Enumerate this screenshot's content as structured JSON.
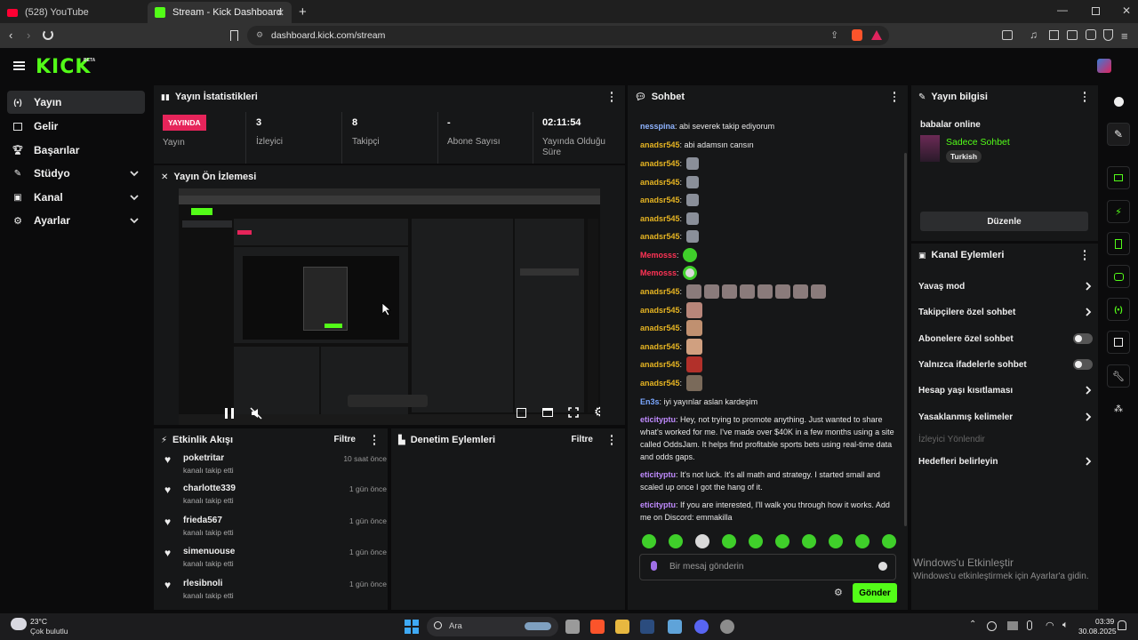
{
  "browser": {
    "tabs": [
      {
        "title": "(528) YouTube"
      },
      {
        "title": "Stream - Kick Dashboard"
      }
    ],
    "url": "dashboard.kick.com/stream"
  },
  "app": {
    "logo": "KICK",
    "logo_badge": "BETA",
    "nav": [
      {
        "label": "Yayın"
      },
      {
        "label": "Gelir"
      },
      {
        "label": "Başarılar"
      },
      {
        "label": "Stüdyo"
      },
      {
        "label": "Kanal"
      },
      {
        "label": "Ayarlar"
      }
    ]
  },
  "stats": {
    "title": "Yayın İstatistikleri",
    "live_badge": "YAYINDA",
    "items": [
      {
        "value": "",
        "label": "Yayın"
      },
      {
        "value": "3",
        "label": "İzleyici"
      },
      {
        "value": "8",
        "label": "Takipçi"
      },
      {
        "value": "-",
        "label": "Abone Sayısı"
      },
      {
        "value": "02:11:54",
        "label": "Yayında Olduğu Süre"
      }
    ]
  },
  "preview": {
    "title": "Yayın Ön İzlemesi"
  },
  "activity": {
    "title": "Etkinlik Akışı",
    "filter": "Filtre",
    "items": [
      {
        "name": "poketritar",
        "sub": "kanalı takip etti",
        "time": "10 saat önce"
      },
      {
        "name": "charlotte339",
        "sub": "kanalı takip etti",
        "time": "1 gün önce"
      },
      {
        "name": "frieda567",
        "sub": "kanalı takip etti",
        "time": "1 gün önce"
      },
      {
        "name": "simenuouse",
        "sub": "kanalı takip etti",
        "time": "1 gün önce"
      },
      {
        "name": "rlesibnoli",
        "sub": "kanalı takip etti",
        "time": "1 gün önce"
      }
    ]
  },
  "moderation": {
    "title": "Denetim Eylemleri",
    "filter": "Filtre"
  },
  "chat": {
    "title": "Sohbet",
    "messages": [
      {
        "user": "nesspina",
        "color": "#8fb4ff",
        "text": "abi severek takip ediyorum"
      },
      {
        "user": "anadsr545",
        "color": "#e6b422",
        "text": "abi adamsın cansın"
      },
      {
        "user": "anadsr545",
        "color": "#e6b422",
        "text": ""
      },
      {
        "user": "anadsr545",
        "color": "#e6b422",
        "text": ""
      },
      {
        "user": "anadsr545",
        "color": "#e6b422",
        "text": ""
      },
      {
        "user": "anadsr545",
        "color": "#e6b422",
        "text": ""
      },
      {
        "user": "anadsr545",
        "color": "#e6b422",
        "text": ""
      },
      {
        "user": "Memosss",
        "color": "#ff3355",
        "text": ""
      },
      {
        "user": "Memosss",
        "color": "#ff3355",
        "text": ""
      },
      {
        "user": "anadsr545",
        "color": "#e6b422",
        "text": ""
      },
      {
        "user": "anadsr545",
        "color": "#e6b422",
        "text": ""
      },
      {
        "user": "anadsr545",
        "color": "#e6b422",
        "text": ""
      },
      {
        "user": "anadsr545",
        "color": "#e6b422",
        "text": ""
      },
      {
        "user": "anadsr545",
        "color": "#e6b422",
        "text": ""
      },
      {
        "user": "anadsr545",
        "color": "#e6b422",
        "text": ""
      },
      {
        "user": "En3s",
        "color": "#7aa7ff",
        "text": "iyi yayınlar aslan kardeşim"
      },
      {
        "user": "eticityptu",
        "color": "#c08bff",
        "text": "Hey, not trying to promote anything. Just wanted to share what's worked for me. I've made over $40K in a few months using a site called OddsJam. It helps find profitable sports bets using real-time data and odds gaps."
      },
      {
        "user": "eticityptu",
        "color": "#c08bff",
        "text": "It's not luck. It's all math and strategy. I started small and scaled up once I got the hang of it."
      },
      {
        "user": "eticityptu",
        "color": "#c08bff",
        "text": "If you are interested, I'll walk you through how it works. Add me on Discord: emmakilla"
      }
    ],
    "input_placeholder": "Bir mesaj gönderin",
    "send": "Gönder"
  },
  "stream_info": {
    "title": "Yayın bilgisi",
    "stream_title": "babalar online",
    "category": "Sadece Sohbet",
    "language": "Turkish",
    "edit": "Düzenle"
  },
  "channel_actions": {
    "title": "Kanal Eylemleri",
    "items": [
      {
        "label": "Yavaş mod",
        "control": "chevron"
      },
      {
        "label": "Takipçilere özel sohbet",
        "control": "chevron"
      },
      {
        "label": "Abonelere özel sohbet",
        "control": "toggle",
        "on": false
      },
      {
        "label": "Yalnızca ifadelerle sohbet",
        "control": "toggle",
        "on": false
      },
      {
        "label": "Hesap yaşı kısıtlaması",
        "control": "chevron"
      },
      {
        "label": "Yasaklanmış kelimeler",
        "control": "chevron"
      },
      {
        "label": "İzleyici Yönlendir",
        "control": "none"
      },
      {
        "label": "Hedefleri belirleyin",
        "control": "chevron"
      }
    ]
  },
  "watermark": {
    "title": "Windows'u Etkinleştir",
    "text": "Windows'u etkinleştirmek için Ayarlar'a gidin."
  },
  "taskbar": {
    "temp": "23°C",
    "weather": "Çok bulutlu",
    "search": "Ara",
    "time": "03:39",
    "date": "30.08.2025"
  },
  "colors": {
    "accent": "#53fc18",
    "live": "#e6245a"
  }
}
